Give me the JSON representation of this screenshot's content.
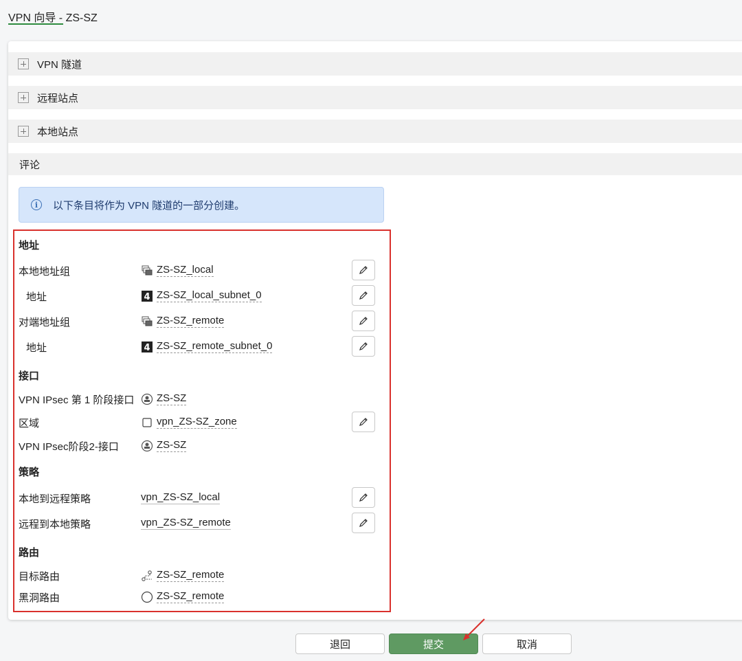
{
  "header": {
    "title": "VPN 向导 - ZS-SZ"
  },
  "sections": [
    {
      "label": "VPN 隧道"
    },
    {
      "label": "远程站点"
    },
    {
      "label": "本地站点"
    },
    {
      "label": "评论"
    }
  ],
  "info": {
    "text": "以下条目将作为 VPN 隧道的一部分创建。"
  },
  "summary": {
    "address": {
      "heading": "地址",
      "local_group_label": "本地地址组",
      "local_group_value": "ZS-SZ_local",
      "local_addr_label": "地址",
      "local_addr_value": "ZS-SZ_local_subnet_0",
      "remote_group_label": "对端地址组",
      "remote_group_value": "ZS-SZ_remote",
      "remote_addr_label": "地址",
      "remote_addr_value": "ZS-SZ_remote_subnet_0"
    },
    "interface": {
      "heading": "接口",
      "phase1_label": "VPN IPsec 第 1 阶段接口",
      "phase1_value": "ZS-SZ",
      "zone_label": "区域",
      "zone_value": "vpn_ZS-SZ_zone",
      "phase2_label": "VPN IPsec阶段2-接口",
      "phase2_value": "ZS-SZ"
    },
    "policy": {
      "heading": "策略",
      "l2r_label": "本地到远程策略",
      "l2r_value": "vpn_ZS-SZ_local",
      "r2l_label": "远程到本地策略",
      "r2l_value": "vpn_ZS-SZ_remote"
    },
    "routing": {
      "heading": "路由",
      "dest_label": "目标路由",
      "dest_value": "ZS-SZ_remote",
      "blackhole_label": "黑洞路由",
      "blackhole_value": "ZS-SZ_remote"
    }
  },
  "buttons": {
    "back": "退回",
    "submit": "提交",
    "cancel": "取消"
  },
  "colors": {
    "accent": "#2e8b3e",
    "submit": "#5f9a62",
    "highlight_border": "#d9302c",
    "info_bg": "#d6e6fb"
  }
}
